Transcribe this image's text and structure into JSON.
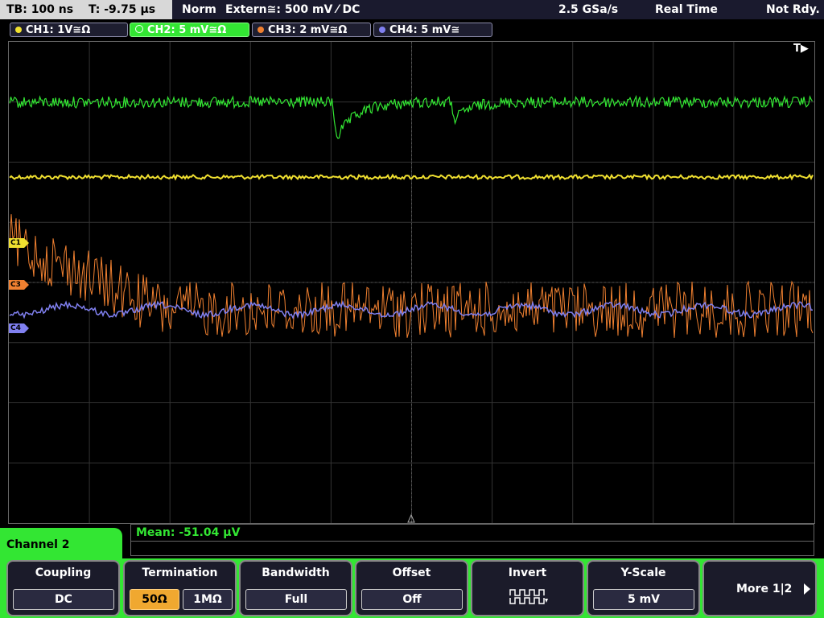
{
  "topbar": {
    "timebase": "TB: 100 ns",
    "trigger_time": "T: -9.75 µs",
    "mode": "Norm",
    "trigger": "Extern≅: 500 mV ⁄ DC",
    "sample_rate": "2.5 GSa/s",
    "acq_mode": "Real Time",
    "status": "Not Rdy."
  },
  "channels": [
    {
      "label": "CH1: 1V≅Ω",
      "color": "#f0e030"
    },
    {
      "label": "CH2: 5 mV≅Ω",
      "color": "#33e633"
    },
    {
      "label": "CH3: 2 mV≅Ω",
      "color": "#f08030"
    },
    {
      "label": "CH4: 5 mV≅",
      "color": "#8080f0"
    }
  ],
  "markers": {
    "c1": "C1",
    "c3": "C3",
    "c4": "C4"
  },
  "trigger_marker": "T",
  "measurement": {
    "text": "Mean: -51.04 µV"
  },
  "channel_menu": {
    "title": "Channel 2"
  },
  "softkeys": {
    "coupling": {
      "title": "Coupling",
      "value": "DC"
    },
    "termination": {
      "title": "Termination",
      "opt1": "50Ω",
      "opt2": "1MΩ"
    },
    "bandwidth": {
      "title": "Bandwidth",
      "value": "Full"
    },
    "offset": {
      "title": "Offset",
      "value": "Off"
    },
    "invert": {
      "title": "Invert",
      "icon": "invert-waveform-icon"
    },
    "yscale": {
      "title": "Y-Scale",
      "value": "5 mV"
    },
    "more": {
      "label": "More 1|2"
    }
  }
}
